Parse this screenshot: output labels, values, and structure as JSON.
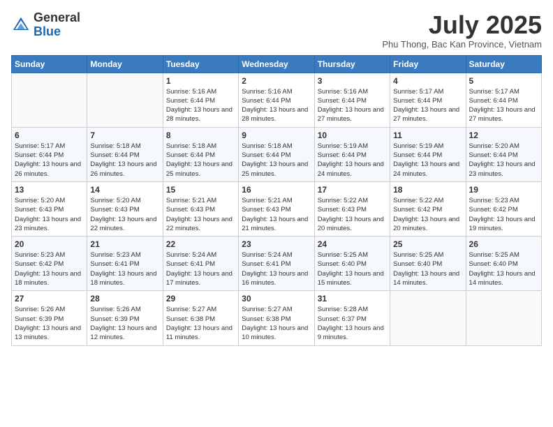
{
  "header": {
    "logo_general": "General",
    "logo_blue": "Blue",
    "month_title": "July 2025",
    "location": "Phu Thong, Bac Kan Province, Vietnam"
  },
  "days_of_week": [
    "Sunday",
    "Monday",
    "Tuesday",
    "Wednesday",
    "Thursday",
    "Friday",
    "Saturday"
  ],
  "weeks": [
    [
      {
        "day": "",
        "info": ""
      },
      {
        "day": "",
        "info": ""
      },
      {
        "day": "1",
        "info": "Sunrise: 5:16 AM\nSunset: 6:44 PM\nDaylight: 13 hours and 28 minutes."
      },
      {
        "day": "2",
        "info": "Sunrise: 5:16 AM\nSunset: 6:44 PM\nDaylight: 13 hours and 28 minutes."
      },
      {
        "day": "3",
        "info": "Sunrise: 5:16 AM\nSunset: 6:44 PM\nDaylight: 13 hours and 27 minutes."
      },
      {
        "day": "4",
        "info": "Sunrise: 5:17 AM\nSunset: 6:44 PM\nDaylight: 13 hours and 27 minutes."
      },
      {
        "day": "5",
        "info": "Sunrise: 5:17 AM\nSunset: 6:44 PM\nDaylight: 13 hours and 27 minutes."
      }
    ],
    [
      {
        "day": "6",
        "info": "Sunrise: 5:17 AM\nSunset: 6:44 PM\nDaylight: 13 hours and 26 minutes."
      },
      {
        "day": "7",
        "info": "Sunrise: 5:18 AM\nSunset: 6:44 PM\nDaylight: 13 hours and 26 minutes."
      },
      {
        "day": "8",
        "info": "Sunrise: 5:18 AM\nSunset: 6:44 PM\nDaylight: 13 hours and 25 minutes."
      },
      {
        "day": "9",
        "info": "Sunrise: 5:18 AM\nSunset: 6:44 PM\nDaylight: 13 hours and 25 minutes."
      },
      {
        "day": "10",
        "info": "Sunrise: 5:19 AM\nSunset: 6:44 PM\nDaylight: 13 hours and 24 minutes."
      },
      {
        "day": "11",
        "info": "Sunrise: 5:19 AM\nSunset: 6:44 PM\nDaylight: 13 hours and 24 minutes."
      },
      {
        "day": "12",
        "info": "Sunrise: 5:20 AM\nSunset: 6:44 PM\nDaylight: 13 hours and 23 minutes."
      }
    ],
    [
      {
        "day": "13",
        "info": "Sunrise: 5:20 AM\nSunset: 6:43 PM\nDaylight: 13 hours and 23 minutes."
      },
      {
        "day": "14",
        "info": "Sunrise: 5:20 AM\nSunset: 6:43 PM\nDaylight: 13 hours and 22 minutes."
      },
      {
        "day": "15",
        "info": "Sunrise: 5:21 AM\nSunset: 6:43 PM\nDaylight: 13 hours and 22 minutes."
      },
      {
        "day": "16",
        "info": "Sunrise: 5:21 AM\nSunset: 6:43 PM\nDaylight: 13 hours and 21 minutes."
      },
      {
        "day": "17",
        "info": "Sunrise: 5:22 AM\nSunset: 6:43 PM\nDaylight: 13 hours and 20 minutes."
      },
      {
        "day": "18",
        "info": "Sunrise: 5:22 AM\nSunset: 6:42 PM\nDaylight: 13 hours and 20 minutes."
      },
      {
        "day": "19",
        "info": "Sunrise: 5:23 AM\nSunset: 6:42 PM\nDaylight: 13 hours and 19 minutes."
      }
    ],
    [
      {
        "day": "20",
        "info": "Sunrise: 5:23 AM\nSunset: 6:42 PM\nDaylight: 13 hours and 18 minutes."
      },
      {
        "day": "21",
        "info": "Sunrise: 5:23 AM\nSunset: 6:41 PM\nDaylight: 13 hours and 18 minutes."
      },
      {
        "day": "22",
        "info": "Sunrise: 5:24 AM\nSunset: 6:41 PM\nDaylight: 13 hours and 17 minutes."
      },
      {
        "day": "23",
        "info": "Sunrise: 5:24 AM\nSunset: 6:41 PM\nDaylight: 13 hours and 16 minutes."
      },
      {
        "day": "24",
        "info": "Sunrise: 5:25 AM\nSunset: 6:40 PM\nDaylight: 13 hours and 15 minutes."
      },
      {
        "day": "25",
        "info": "Sunrise: 5:25 AM\nSunset: 6:40 PM\nDaylight: 13 hours and 14 minutes."
      },
      {
        "day": "26",
        "info": "Sunrise: 5:25 AM\nSunset: 6:40 PM\nDaylight: 13 hours and 14 minutes."
      }
    ],
    [
      {
        "day": "27",
        "info": "Sunrise: 5:26 AM\nSunset: 6:39 PM\nDaylight: 13 hours and 13 minutes."
      },
      {
        "day": "28",
        "info": "Sunrise: 5:26 AM\nSunset: 6:39 PM\nDaylight: 13 hours and 12 minutes."
      },
      {
        "day": "29",
        "info": "Sunrise: 5:27 AM\nSunset: 6:38 PM\nDaylight: 13 hours and 11 minutes."
      },
      {
        "day": "30",
        "info": "Sunrise: 5:27 AM\nSunset: 6:38 PM\nDaylight: 13 hours and 10 minutes."
      },
      {
        "day": "31",
        "info": "Sunrise: 5:28 AM\nSunset: 6:37 PM\nDaylight: 13 hours and 9 minutes."
      },
      {
        "day": "",
        "info": ""
      },
      {
        "day": "",
        "info": ""
      }
    ]
  ]
}
